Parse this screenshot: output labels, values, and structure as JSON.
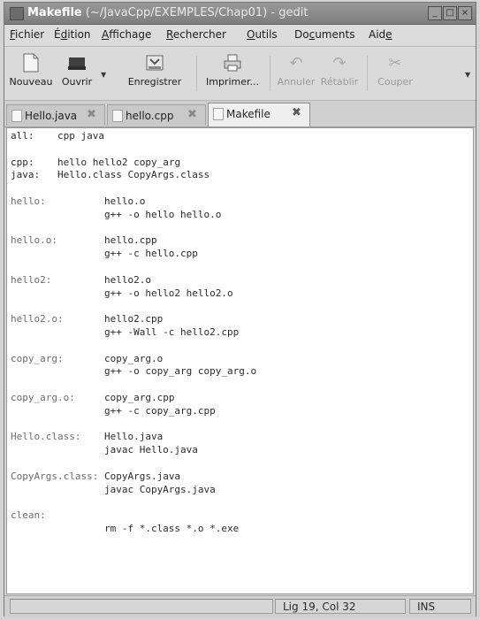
{
  "window": {
    "title_file": "Makefile",
    "title_rest": " (~/JavaCpp/EXEMPLES/Chap01) - gedit",
    "controls": [
      "_",
      "□",
      "×"
    ]
  },
  "menu": [
    {
      "pre": "",
      "u": "F",
      "post": "ichier"
    },
    {
      "pre": "É",
      "u": "d",
      "post": "ition"
    },
    {
      "pre": "",
      "u": "A",
      "post": "ffichage"
    },
    {
      "pre": "",
      "u": "R",
      "post": "echercher"
    },
    {
      "pre": "",
      "u": "O",
      "post": "utils"
    },
    {
      "pre": "Do",
      "u": "c",
      "post": "uments"
    },
    {
      "pre": "Aid",
      "u": "e",
      "post": ""
    }
  ],
  "toolbar": {
    "new": "Nouveau",
    "open": "Ouvrir",
    "save": "Enregistrer",
    "print": "Imprimer...",
    "undo": "Annuler",
    "redo": "Rétablir",
    "cut": "Couper"
  },
  "tabs": [
    {
      "label": "Hello.java",
      "active": false
    },
    {
      "label": "hello.cpp",
      "active": false
    },
    {
      "label": "Makefile",
      "active": true
    }
  ],
  "code_lines": [
    [
      {
        "t": "all:",
        "c": "plain"
      },
      {
        "t": "    cpp java",
        "c": "plain"
      }
    ],
    [],
    [
      {
        "t": "cpp:",
        "c": "plain"
      },
      {
        "t": "    hello hello2 copy_arg",
        "c": "plain"
      }
    ],
    [
      {
        "t": "java:",
        "c": "plain"
      },
      {
        "t": "   Hello.class CopyArgs.class",
        "c": "plain"
      }
    ],
    [],
    [
      {
        "t": "hello:",
        "c": "tg"
      },
      {
        "t": "          hello.o",
        "c": "plain"
      }
    ],
    [
      {
        "t": "                g++ -o hello hello.o",
        "c": "plain"
      }
    ],
    [],
    [
      {
        "t": "hello.o:",
        "c": "tg"
      },
      {
        "t": "        hello.cpp",
        "c": "plain"
      }
    ],
    [
      {
        "t": "                g++ -c hello.cpp",
        "c": "plain"
      }
    ],
    [],
    [
      {
        "t": "hello2:",
        "c": "tg"
      },
      {
        "t": "         hello2.o",
        "c": "plain"
      }
    ],
    [
      {
        "t": "                g++ -o hello2 hello2.o",
        "c": "plain"
      }
    ],
    [],
    [
      {
        "t": "hello2.o:",
        "c": "tg"
      },
      {
        "t": "       hello2.cpp",
        "c": "plain"
      }
    ],
    [
      {
        "t": "                g++ -Wall -c hello2.cpp",
        "c": "plain"
      }
    ],
    [],
    [
      {
        "t": "copy_arg:",
        "c": "tg"
      },
      {
        "t": "       copy_arg.o",
        "c": "plain"
      }
    ],
    [
      {
        "t": "                g++ -o copy_arg copy_arg.o",
        "c": "plain"
      }
    ],
    [],
    [
      {
        "t": "copy_arg.o:",
        "c": "tg"
      },
      {
        "t": "     copy_arg.cpp",
        "c": "plain"
      }
    ],
    [
      {
        "t": "                g++ -c copy_arg.cpp",
        "c": "plain"
      }
    ],
    [],
    [
      {
        "t": "Hello.class:",
        "c": "tg"
      },
      {
        "t": "    Hello.java",
        "c": "plain"
      }
    ],
    [
      {
        "t": "                javac Hello.java",
        "c": "plain"
      }
    ],
    [],
    [
      {
        "t": "CopyArgs.class:",
        "c": "tg"
      },
      {
        "t": " CopyArgs.java",
        "c": "plain"
      }
    ],
    [
      {
        "t": "                javac CopyArgs.java",
        "c": "plain"
      }
    ],
    [],
    [
      {
        "t": "clean:",
        "c": "tg"
      }
    ],
    [
      {
        "t": "                rm -f *.class *.o *.exe",
        "c": "plain"
      }
    ]
  ],
  "status": {
    "position": "Lig 19, Col 32",
    "mode": "INS"
  }
}
